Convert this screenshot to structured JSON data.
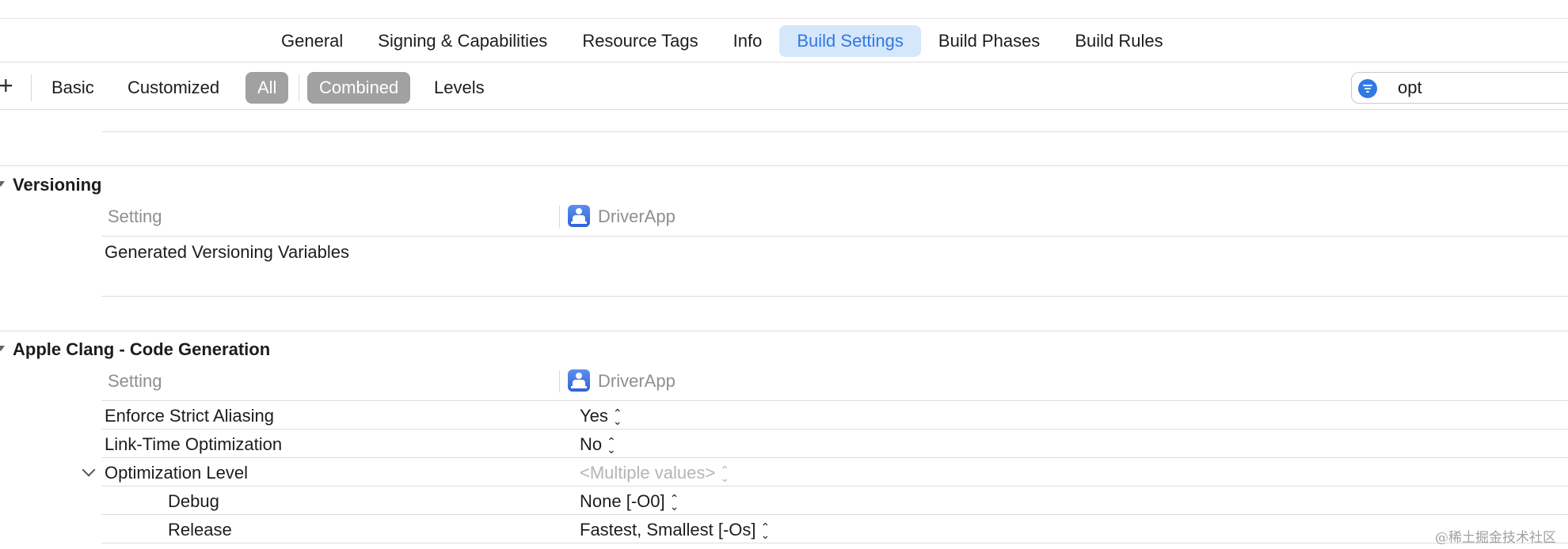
{
  "tabs": [
    {
      "label": "General"
    },
    {
      "label": "Signing & Capabilities"
    },
    {
      "label": "Resource Tags"
    },
    {
      "label": "Info"
    },
    {
      "label": "Build Settings",
      "active": true
    },
    {
      "label": "Build Phases"
    },
    {
      "label": "Build Rules"
    }
  ],
  "filterbar": {
    "plus": "+",
    "basic": "Basic",
    "customized": "Customized",
    "all": "All",
    "combined": "Combined",
    "levels": "Levels",
    "search_value": "opt"
  },
  "sections": {
    "versioning": {
      "title": "Versioning",
      "col_setting": "Setting",
      "col_target": "DriverApp",
      "rows": [
        {
          "label": "Generated Versioning Variables",
          "value": ""
        }
      ]
    },
    "clang": {
      "title": "Apple Clang - Code Generation",
      "col_setting": "Setting",
      "col_target": "DriverApp",
      "rows": [
        {
          "label": "Enforce Strict Aliasing",
          "value": "Yes"
        },
        {
          "label": "Link-Time Optimization",
          "value": "No"
        },
        {
          "label": "Optimization Level",
          "value": "<Multiple values>"
        },
        {
          "label": "Debug",
          "value": "None [-O0]"
        },
        {
          "label": "Release",
          "value": "Fastest, Smallest [-Os]"
        }
      ]
    }
  },
  "watermark": "@稀土掘金技术社区",
  "colors": {
    "accent": "#2f7ae5",
    "active_tab_bg": "#d6e6fb",
    "segment_selected": "#a1a1a1"
  }
}
